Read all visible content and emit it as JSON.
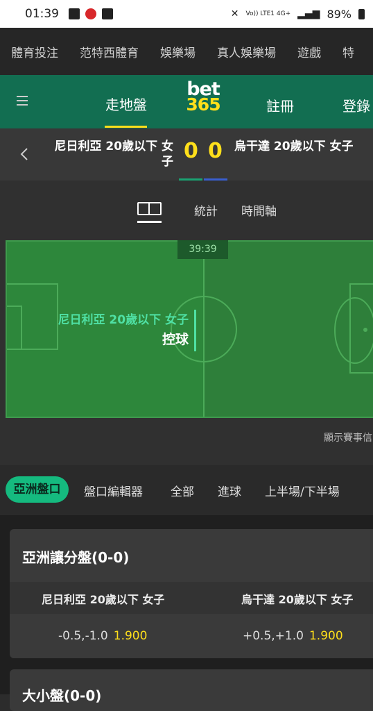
{
  "status_bar": {
    "time": "01:39",
    "network": "Vo)) LTE1 4G+",
    "battery": "89%"
  },
  "top_nav": {
    "items": [
      "體育投注",
      "范特西體育",
      "娛樂場",
      "真人娛樂場",
      "遊戲",
      "特"
    ]
  },
  "header": {
    "live": "走地盤",
    "logo_top": "bet",
    "logo_bottom": "365",
    "register": "註冊",
    "login": "登錄"
  },
  "match": {
    "home": "尼日利亞 20歲以下 女子",
    "away": "烏干達 20歲以下 女子",
    "home_score": "0",
    "away_score": "0"
  },
  "view_tabs": {
    "stats": "統計",
    "timeline": "時間軸"
  },
  "pitch": {
    "timer": "39:39",
    "possession_team": "尼日利亞 20歲以下 女子",
    "possession_label": "控球"
  },
  "show_events": "顯示賽事信",
  "market_tabs": {
    "active": "亞洲盤口",
    "items": [
      "盤口編輯器",
      "全部",
      "進球",
      "上半場/下半場"
    ]
  },
  "asian_handicap": {
    "title": "亞洲讓分盤(0-0)",
    "home_label": "尼日利亞 20歲以下 女子",
    "away_label": "烏干達 20歲以下 女子",
    "home_line": "-0.5,-1.0",
    "home_odds": "1.900",
    "away_line": "+0.5,+1.0",
    "away_odds": "1.900"
  },
  "over_under": {
    "title": "大小盤(0-0)"
  },
  "colors": {
    "brand_green": "#126e51",
    "accent_yellow": "#ffdf1b",
    "active_tab": "#15ba7f"
  }
}
